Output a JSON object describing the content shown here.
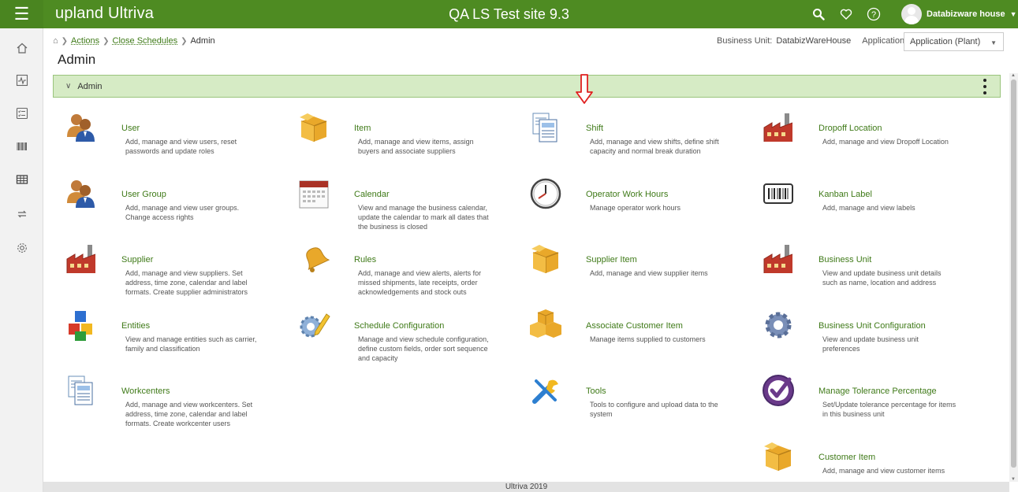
{
  "header": {
    "logo_upland": "upland",
    "logo_ultriva": "Ultriva",
    "site_title": "QA LS Test site 9.3",
    "user_name": "Databizware house"
  },
  "breadcrumb": {
    "items": [
      "Actions",
      "Close Schedules",
      "Admin"
    ]
  },
  "page_title": "Admin",
  "business_unit": {
    "label": "Business Unit:",
    "value": "DatabizWareHouse",
    "app_label": "Application:",
    "app_value": "Application (Plant)"
  },
  "panel": {
    "title": "Admin"
  },
  "cards": [
    {
      "title": "User",
      "desc": "Add, manage and view users, reset passwords and update roles",
      "icon": "users-icon"
    },
    {
      "title": "Item",
      "desc": "Add, manage and view items, assign buyers and associate suppliers",
      "icon": "box-icon"
    },
    {
      "title": "Shift",
      "desc": "Add, manage and view shifts, define shift capacity and normal break duration",
      "icon": "documents-icon"
    },
    {
      "title": "Dropoff Location",
      "desc": "Add, manage and view Dropoff Location",
      "icon": "factory-icon"
    },
    {
      "title": "User Group",
      "desc": "Add, manage and view user groups. Change access rights",
      "icon": "users-icon"
    },
    {
      "title": "Calendar",
      "desc": "View and manage the business calendar, update the calendar to mark all dates that the business is closed",
      "icon": "calendar-icon"
    },
    {
      "title": "Operator Work Hours",
      "desc": "Manage operator work hours",
      "icon": "clock-icon"
    },
    {
      "title": "Kanban Label",
      "desc": "Add, manage and view labels",
      "icon": "barcode-icon"
    },
    {
      "title": "Supplier",
      "desc": "Add, manage and view suppliers. Set address, time zone, calendar and label formats. Create supplier administrators",
      "icon": "factory-icon"
    },
    {
      "title": "Rules",
      "desc": "Add, manage and view alerts, alerts for missed shipments, late receipts, order acknowledgements and stock outs",
      "icon": "bell-icon"
    },
    {
      "title": "Supplier Item",
      "desc": "Add, manage and view supplier items",
      "icon": "box-icon"
    },
    {
      "title": "Business Unit",
      "desc": "View and update business unit details such as name, location and address",
      "icon": "factory-icon"
    },
    {
      "title": "Entities",
      "desc": "View and manage entities such as carrier, family and classification",
      "icon": "blocks-icon"
    },
    {
      "title": "Schedule Configuration",
      "desc": "Manage and view schedule configuration, define custom fields, order sort sequence and capacity",
      "icon": "pencil-gear-icon"
    },
    {
      "title": "Associate Customer Item",
      "desc": "Manage items supplied to customers",
      "icon": "boxes-icon"
    },
    {
      "title": "Business Unit Configuration",
      "desc": "View and update business unit preferences",
      "icon": "gear-icon"
    },
    {
      "title": "Workcenters",
      "desc": "Add, manage and view workcenters. Set address, time zone, calendar and label formats. Create workcenter users",
      "icon": "documents-icon"
    },
    {
      "title": "Tools",
      "desc": "Tools to configure and upload data to the system",
      "icon": "tools-icon"
    },
    {
      "title": "Manage Tolerance Percentage",
      "desc": "Set/Update tolerance percentage for items in this business unit",
      "icon": "check-badge-icon"
    },
    {
      "title": "Customer Item",
      "desc": "Add, manage and view customer items",
      "icon": "box-icon"
    }
  ],
  "footer": "Ultriva 2019",
  "colors": {
    "topbar": "#4e8b22",
    "link": "#3f7a18",
    "panel_header": "#d6ebc5",
    "arrow": "#e02020"
  }
}
